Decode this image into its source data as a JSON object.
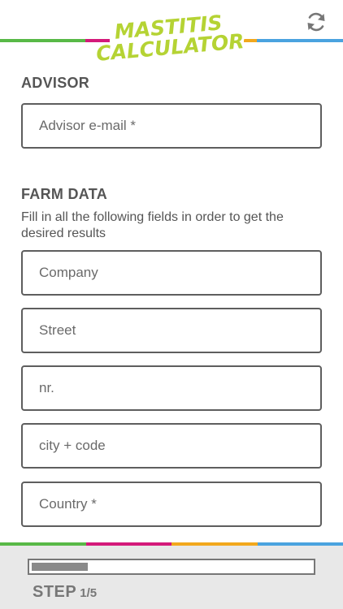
{
  "header": {
    "logo_line1": "MASTITIS",
    "logo_line2": "CALCULATOR",
    "refresh_icon": "refresh-icon"
  },
  "colors": {
    "green": "#58b947",
    "pink": "#d4197a",
    "orange": "#f2a81d",
    "blue": "#4aa3df",
    "logo_green": "#b5d334"
  },
  "advisor": {
    "title": "ADVISOR",
    "email_placeholder": "Advisor e-mail *"
  },
  "farm": {
    "title": "FARM DATA",
    "description": "Fill in all the following fields in order to get the desired results",
    "company_placeholder": "Company",
    "street_placeholder": "Street",
    "nr_placeholder": "nr.",
    "city_placeholder": "city + code",
    "country_placeholder": "Country *"
  },
  "footer": {
    "progress_fraction": 0.2,
    "step_label": "STEP",
    "step_value": "1/5"
  }
}
